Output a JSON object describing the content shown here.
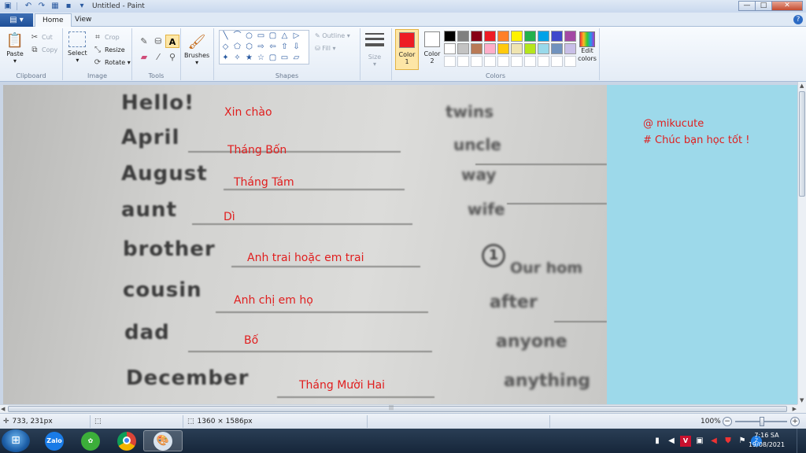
{
  "window": {
    "title": "Untitled - Paint",
    "minimize": "—",
    "maximize": "□",
    "close": "✕"
  },
  "tabs": {
    "file_menu": "▤ ▾",
    "home": "Home",
    "view": "View"
  },
  "ribbon": {
    "clipboard": {
      "label": "Clipboard",
      "paste": "Paste",
      "cut": "Cut",
      "copy": "Copy"
    },
    "image": {
      "label": "Image",
      "select": "Select",
      "crop": "Crop",
      "resize": "Resize",
      "rotate": "Rotate ▾"
    },
    "tools": {
      "label": "Tools"
    },
    "brushes": {
      "label": "Brushes"
    },
    "shapes": {
      "label": "Shapes",
      "outline": "Outline ▾",
      "fill": "Fill ▾",
      "glyphs": [
        "╲",
        "⌒",
        "○",
        "▭",
        "▢",
        "△",
        "▷",
        "◇",
        "⬠",
        "⬡",
        "⇨",
        "⇦",
        "⇧",
        "⇩",
        "✦",
        "✧",
        "★",
        "☆",
        "▢",
        "▭",
        "▱",
        "◌",
        "♡",
        "⚡"
      ]
    },
    "size": {
      "label": "Size"
    },
    "colors": {
      "label": "Colors",
      "color1": "Color 1",
      "color2": "Color 2",
      "edit": "Edit colors",
      "color1_value": "#ed1c24",
      "color2_value": "#ffffff",
      "palette": [
        "#000000",
        "#7f7f7f",
        "#880015",
        "#ed1c24",
        "#ff7f27",
        "#fff200",
        "#22b14c",
        "#00a2e8",
        "#3f48cc",
        "#a349a4",
        "#ffffff",
        "#c3c3c3",
        "#b97a57",
        "#ffaec9",
        "#ffc90e",
        "#efe4b0",
        "#b5e61d",
        "#99d9ea",
        "#7092be",
        "#c8bfe7"
      ]
    }
  },
  "canvas": {
    "english_words": [
      "Hello!",
      "April",
      "August",
      "aunt",
      "brother",
      "cousin",
      "dad",
      "December"
    ],
    "right_words": [
      "twins",
      "uncle",
      "way",
      "wife",
      "Our hom",
      "after",
      "anyone",
      "anything"
    ],
    "circle_number": "1",
    "vietnamese": [
      "Xin chào",
      "Tháng Bốn",
      "Tháng Tám",
      "Dì",
      "Anh trai hoặc em trai",
      "Anh chị em họ",
      "Bố",
      "Tháng Mười Hai"
    ],
    "note_line1": "@ mikucute",
    "note_line2": "# Chúc bạn học tốt !"
  },
  "statusbar": {
    "cursor_pos": "733, 231px",
    "image_size": "1360 × 1586px",
    "zoom": "100%"
  },
  "taskbar": {
    "zalo_label": "Zalo",
    "time": "7:16 SA",
    "date": "19/08/2021"
  }
}
